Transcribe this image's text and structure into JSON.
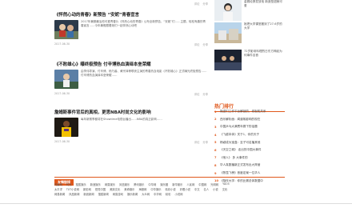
{
  "top_meta": {
    "date": "",
    "comment": "评论",
    "share": "分享"
  },
  "articles": [
    {
      "title": "《怦然心动的青春》新预告 “安妮”青春宣言",
      "excerpt": "2017年暑期最治愈可爱青春片《怦然心动的青春》公布全新预告，“安妮”们……主题，轻松有趣的青春宣言……今年暑假跟着她们一起怦然心动吧",
      "date": "2017-06-30",
      "comment": "评论",
      "share": "分享"
    },
    {
      "title": "《不败雄心》曝终极预告 付辛博热血演绎本垒荣耀",
      "excerpt": "由李伟导演，付辛博、杨乃馨、黄宗泽等联袂主演的青春热血电影《不败雄心》正式曝光终极预告……付辛博热血演绎本垒荣耀……",
      "date": "2017-06-30",
      "comment": "评论",
      "share": "分享"
    },
    {
      "title": "詹姆斯事件背后的真相，更思NBA时尚文化的影响",
      "excerpt": "每年新赛季都将在Showtime电视台播出……NBA的真正影响……",
      "date": "2017-06-30",
      "comment": "评论",
      "share": "分享"
    }
  ],
  "sidebar_items": [
    {
      "text": "金赛纶撩发放电 新造型甜美可爱"
    },
    {
      "text": "她把大学课堂搬到了27-6岁的大学"
    },
    {
      "text": "72岁影帝料理烈日东方神起为何事件自首"
    }
  ],
  "ranking": {
    "title": "热门排行",
    "items": [
      "叛逆们工作平台解锁的，老板知关系",
      "西乐解析面：闻道故影响的现在",
      "中国乒乓大满贯年赛下的话题",
      "《飞越本体》关于1，你的天子",
      "杨颖成为宝盒：至子可名播其他",
      "《天空之城》 走出的中国大事件",
      "《他人》 多 大事件的",
      "华人真剧播新正式发布出大阵营",
      "《陈昆飞榜》首度定案一位华人",
      "《陪伴大学：你的比赛总体数据中"
    ]
  },
  "friend_links": {
    "title": "友情链接",
    "rows": [
      [
        "鸟巢网",
        "时光",
        "搜狐娱乐",
        "新浪娱乐",
        "网易娱乐",
        "凤凰娱乐",
        "腾讯娱乐",
        "中华网",
        "娱乐圈",
        "新华娱乐",
        "人民网",
        "中国网",
        "光明网",
        "YAO5"
      ],
      [
        "太平洋",
        "TXT小说网",
        "新影网",
        "视觉中国",
        "美篇文化",
        "美奇娱乐",
        "海报网",
        "中华娱乐",
        "精彩小说",
        "好看小说",
        "中文",
        "名人",
        "小说",
        "文化"
      ],
      [
        "网易新闻",
        "凤凰新闻",
        "新浪新闻",
        "搜狐新闻",
        "网易游戏",
        "娱乐新闻",
        "大众网",
        "中华网",
        "精彩",
        "小说网"
      ]
    ]
  }
}
